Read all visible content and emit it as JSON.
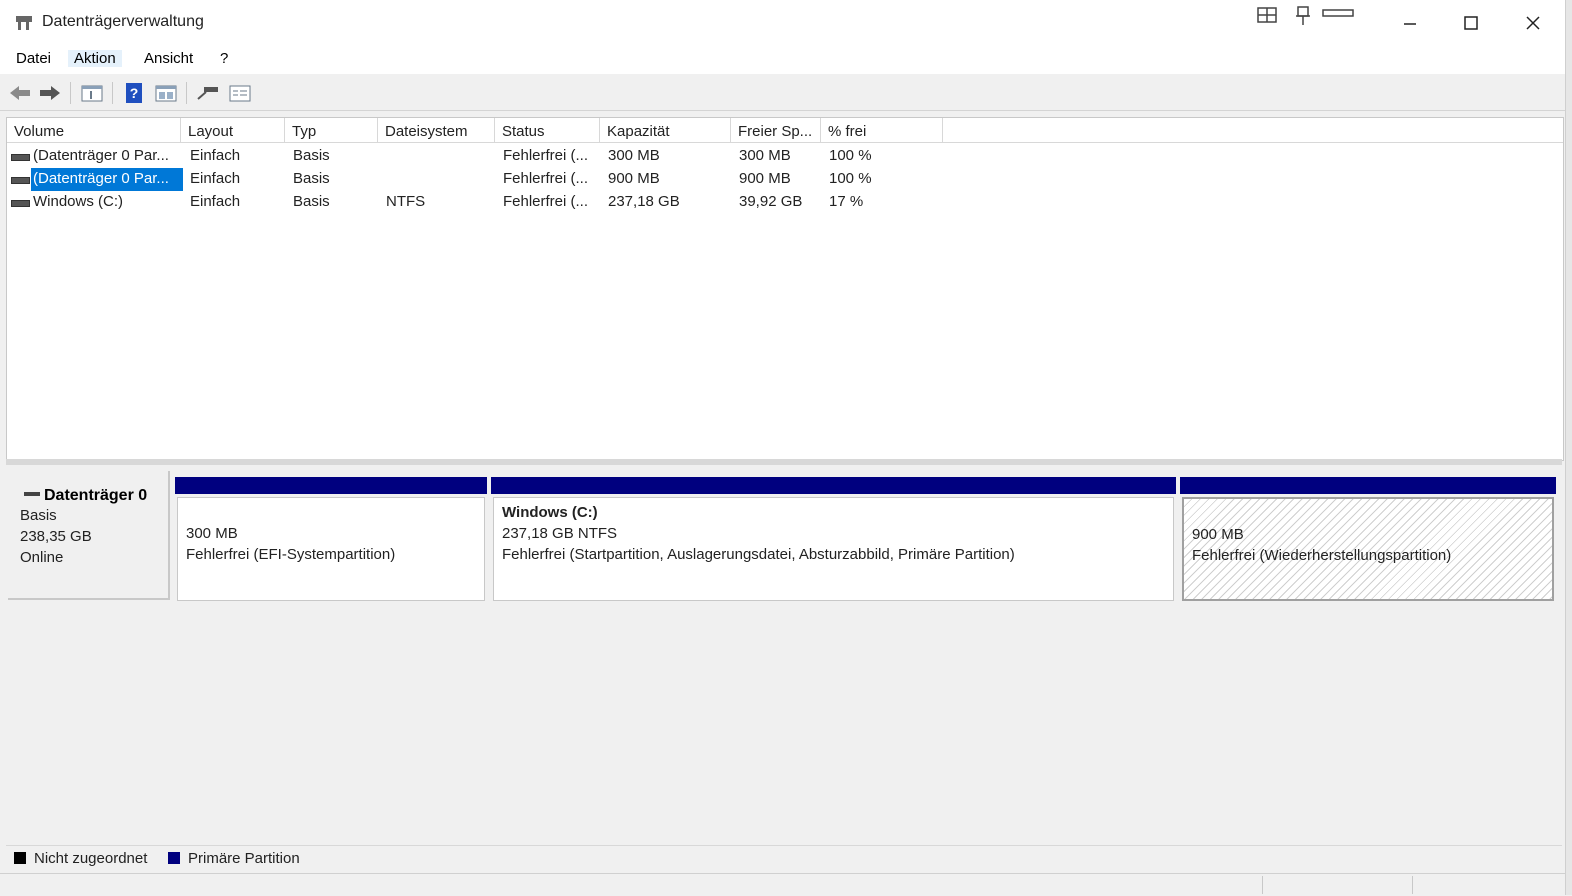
{
  "window": {
    "title": "Datenträgerverwaltung"
  },
  "menu": {
    "items": [
      "Datei",
      "Aktion",
      "Ansicht",
      "?"
    ]
  },
  "toolbar": {
    "icons": [
      "back-arrow-icon",
      "forward-arrow-icon",
      "console-tree-icon",
      "help-icon",
      "properties-list-icon",
      "connect-icon",
      "details-view-icon"
    ]
  },
  "volumes": {
    "headers": [
      "Volume",
      "Layout",
      "Typ",
      "Dateisystem",
      "Status",
      "Kapazität",
      "Freier Sp...",
      "% frei"
    ],
    "rows": [
      [
        "(Datenträger 0 Par...",
        "Einfach",
        "Basis",
        "",
        "Fehlerfrei (...",
        "300 MB",
        "300 MB",
        "100 %"
      ],
      [
        "(Datenträger 0 Par...",
        "Einfach",
        "Basis",
        "",
        "Fehlerfrei (...",
        "900 MB",
        "900 MB",
        "100 %"
      ],
      [
        "Windows (C:)",
        "Einfach",
        "Basis",
        "NTFS",
        "Fehlerfrei (...",
        "237,18 GB",
        "39,92 GB",
        "17 %"
      ]
    ],
    "selected_row": 1
  },
  "disk": {
    "name": "Datenträger 0",
    "type": "Basis",
    "size": "238,35 GB",
    "state": "Online",
    "partitions": [
      {
        "label": "",
        "size": "300 MB",
        "status": "Fehlerfrei (EFI-Systempartition)",
        "hatched": false
      },
      {
        "label": "Windows  (C:)",
        "size": "237,18 GB NTFS",
        "status": "Fehlerfrei (Startpartition, Auslagerungsdatei, Absturzabbild, Primäre Partition)",
        "hatched": false
      },
      {
        "label": "",
        "size": "900 MB",
        "status": "Fehlerfrei (Wiederherstellungspartition)",
        "hatched": true
      }
    ]
  },
  "legend": [
    {
      "label": "Nicht zugeordnet",
      "color": "#000000"
    },
    {
      "label": "Primäre Partition",
      "color": "#00007f"
    }
  ],
  "colors": {
    "selection": "#0078d7",
    "primary_partition": "#00007f"
  }
}
